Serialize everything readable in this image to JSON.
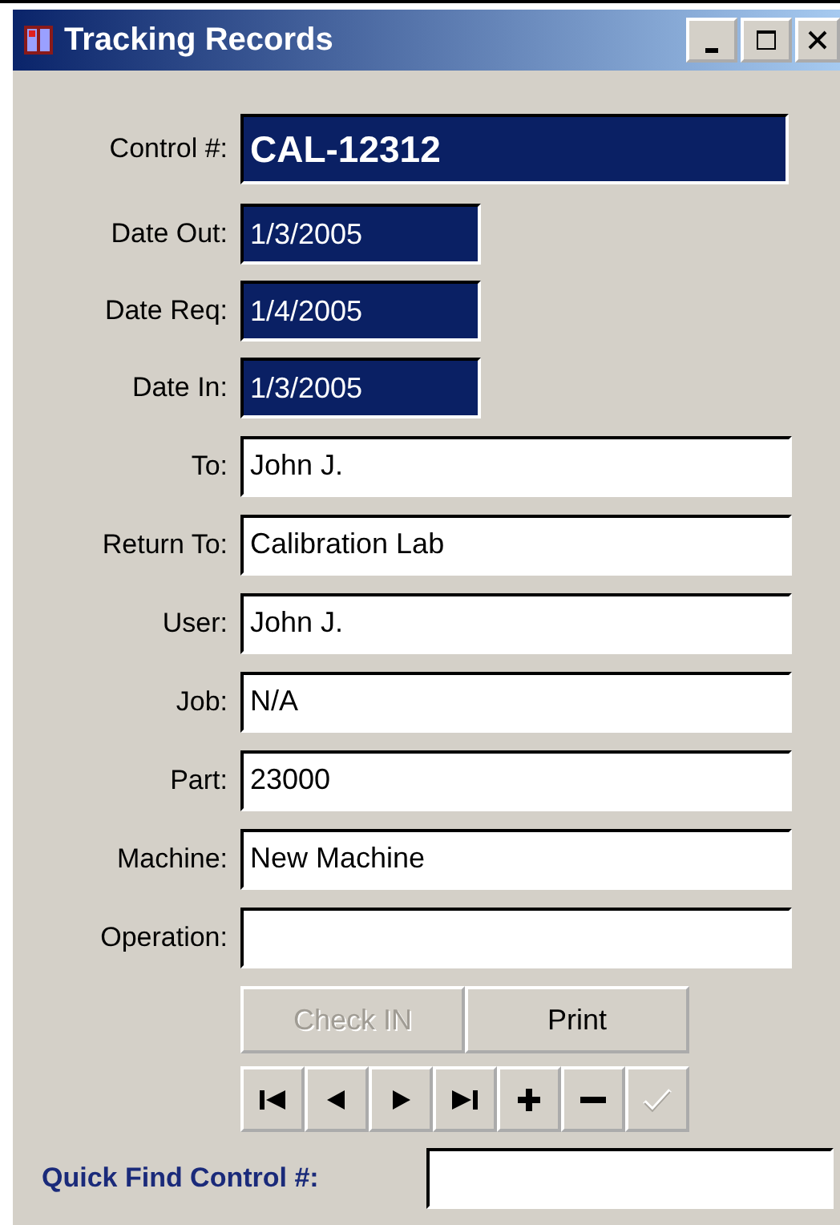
{
  "window": {
    "title": "Tracking Records"
  },
  "fields": [
    {
      "label": "Control #:",
      "value": "CAL-12312",
      "kind": "control"
    },
    {
      "label": "Date Out:",
      "value": "1/3/2005",
      "kind": "date"
    },
    {
      "label": "Date Req:",
      "value": "1/4/2005",
      "kind": "date"
    },
    {
      "label": "Date In:",
      "value": "1/3/2005",
      "kind": "date"
    },
    {
      "label": "To:",
      "value": "John J.",
      "kind": "text"
    },
    {
      "label": "Return To:",
      "value": "Calibration Lab",
      "kind": "text"
    },
    {
      "label": "User:",
      "value": "John J.",
      "kind": "text"
    },
    {
      "label": "Job:",
      "value": "N/A",
      "kind": "text"
    },
    {
      "label": "Part:",
      "value": "23000",
      "kind": "text"
    },
    {
      "label": "Machine:",
      "value": "New Machine",
      "kind": "text"
    },
    {
      "label": "Operation:",
      "kind": "text"
    }
  ],
  "buttons": [
    {
      "label": "Check IN",
      "disabled": true
    },
    {
      "label": "Print",
      "disabled": false
    }
  ],
  "navigator": [
    {
      "kind": "first",
      "disabled": false
    },
    {
      "kind": "prev",
      "disabled": false
    },
    {
      "kind": "next",
      "disabled": false
    },
    {
      "kind": "last",
      "disabled": false
    },
    {
      "kind": "add",
      "disabled": false
    },
    {
      "kind": "delete",
      "disabled": false
    },
    {
      "kind": "save",
      "disabled": true
    }
  ],
  "quick_find": {
    "label": "Quick Find Control #:"
  }
}
